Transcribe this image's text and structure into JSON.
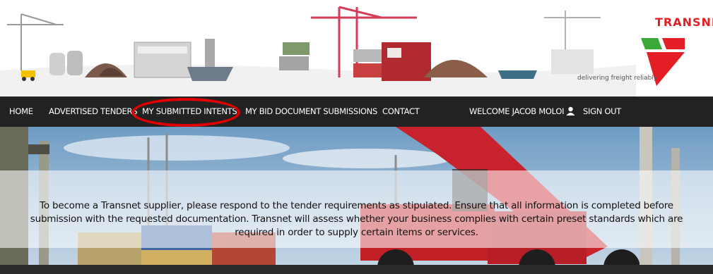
{
  "brand": {
    "name": "TRANSNET",
    "tagline": "delivering freight reliably",
    "red": "#e31e24",
    "green": "#3aa935"
  },
  "nav": {
    "items": [
      {
        "label": "HOME"
      },
      {
        "label": "ADVERTISED TENDERS"
      },
      {
        "label": "MY SUBMITTED INTENTS"
      },
      {
        "label": "MY BID DOCUMENT SUBMISSIONS"
      },
      {
        "label": "CONTACT"
      }
    ],
    "welcome": "WELCOME JACOB MOLOI",
    "signout": "SIGN OUT",
    "highlighted": "MY SUBMITTED INTENTS",
    "highlight_color": "#e00000"
  },
  "hero": {
    "text": "To become a Transnet supplier, please respond to the tender requirements as stipulated. Ensure that all information is completed before submission with the requested documentation. Transnet will assess whether your business complies with certain preset standards which are required in order to supply certain items or services."
  }
}
